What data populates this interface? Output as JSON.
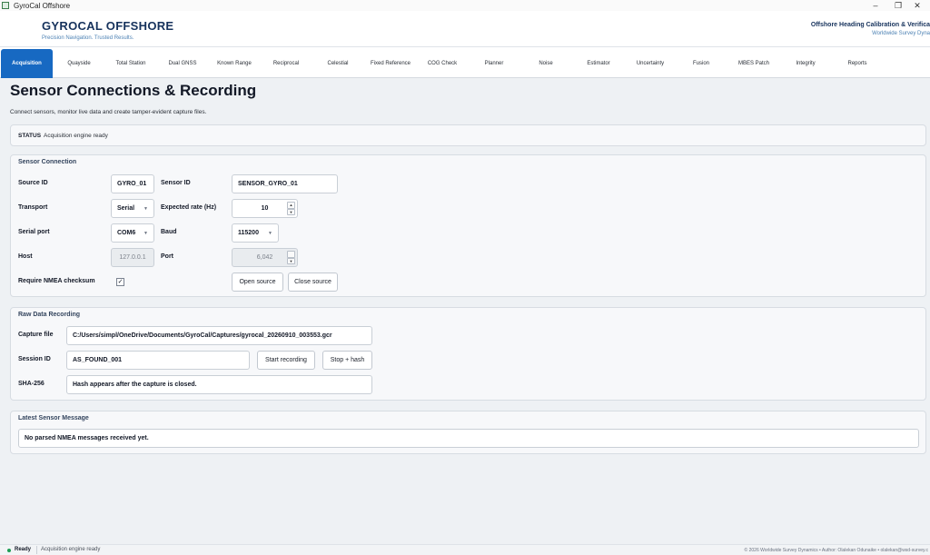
{
  "window": {
    "title": "GyroCal Offshore",
    "minimize": "–",
    "maximize": "❐",
    "close": "✕"
  },
  "header": {
    "brand": "GYROCAL OFFSHORE",
    "tagline": "Precision Navigation. Trusted Results.",
    "right_title": "Offshore Heading Calibration & Verifica",
    "right_sub": "Worldwide Survey Dyna"
  },
  "tabs": [
    "Acquisition",
    "Quayside",
    "Total Station",
    "Dual GNSS",
    "Known Range",
    "Reciprocal",
    "Celestial",
    "Fixed Reference",
    "COG Check",
    "Planner",
    "Noise",
    "Estimator",
    "Uncertainty",
    "Fusion",
    "MBES Patch",
    "Integrity",
    "Reports"
  ],
  "active_tab": "Acquisition",
  "page": {
    "title": "Sensor Connections & Recording",
    "subtitle": "Connect sensors, monitor live data and create tamper-evident capture files."
  },
  "status": {
    "key": "STATUS",
    "value": "Acquisition engine ready"
  },
  "sensor_connection": {
    "title": "Sensor Connection",
    "source_id_label": "Source ID",
    "source_id": "GYRO_01",
    "sensor_id_label": "Sensor ID",
    "sensor_id": "SENSOR_GYRO_01",
    "transport_label": "Transport",
    "transport": "Serial",
    "expected_rate_label": "Expected rate (Hz)",
    "expected_rate": "10",
    "serial_port_label": "Serial port",
    "serial_port": "COM6",
    "baud_label": "Baud",
    "baud": "115200",
    "host_label": "Host",
    "host": "127.0.0.1",
    "port_label": "Port",
    "port": "6,042",
    "require_checksum_label": "Require NMEA checksum",
    "require_checksum_mark": "✓",
    "open_source": "Open source",
    "close_source": "Close source"
  },
  "raw_recording": {
    "title": "Raw Data Recording",
    "capture_file_label": "Capture file",
    "capture_file": "C:/Users/simpl/OneDrive/Documents/GyroCal/Captures/gyrocal_20260910_003553.gcr",
    "session_id_label": "Session ID",
    "session_id": "AS_FOUND_001",
    "start_recording": "Start recording",
    "stop_hash": "Stop + hash",
    "sha_label": "SHA-256",
    "sha_value": "Hash appears after the capture is closed."
  },
  "latest_message": {
    "title": "Latest Sensor Message",
    "value": "No parsed NMEA messages received yet."
  },
  "footer": {
    "ready": "Ready",
    "message": "Acquisition engine ready",
    "credit": "© 2026 Worldwide Survey Dynamics  •  Author: Olalekan Odunaike  •  olalekan@wsd-survey.c"
  },
  "colors": {
    "accent": "#1769c2",
    "brand": "#16325c",
    "ready": "#1f9d55"
  }
}
